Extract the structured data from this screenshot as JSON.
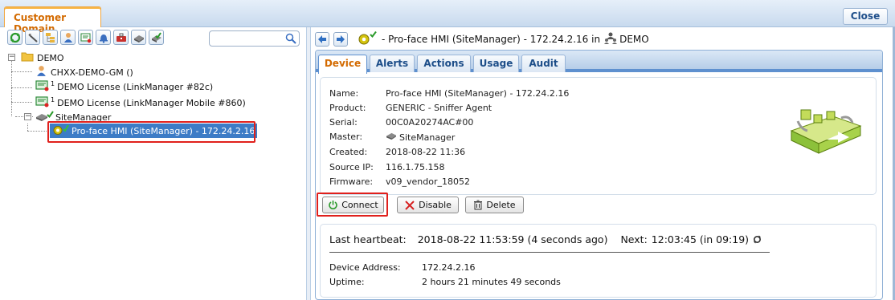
{
  "window": {
    "tab_title": "Customer Domain",
    "close_label": "Close"
  },
  "search": {
    "value": "",
    "placeholder": ""
  },
  "toolbar": {
    "icons": [
      "refresh-icon",
      "tools-icon",
      "hierarchy-icon",
      "user-icon",
      "certificate-icon",
      "alarm-icon",
      "toolbox-icon",
      "device-icon",
      "device-check-icon"
    ]
  },
  "tree": {
    "root": "DEMO",
    "items": [
      {
        "label": "CHXX-DEMO-GM ()",
        "icon": "user-icon"
      },
      {
        "label": "DEMO License (LinkManager #82c)",
        "icon": "license-icon",
        "superscript": "1"
      },
      {
        "label": "DEMO License (LinkManager Mobile #860)",
        "icon": "license-icon",
        "superscript": "1"
      },
      {
        "label": "SiteManager",
        "icon": "sitemanager-icon"
      },
      {
        "label": "Pro-face HMI (SiteManager) - 172.24.2.16",
        "icon": "agent-gear-icon",
        "selected": true
      }
    ]
  },
  "header": {
    "title": "- Pro-face HMI (SiteManager) - 172.24.2.16 in",
    "domain": "DEMO"
  },
  "tabs": [
    {
      "label": "Device",
      "active": true
    },
    {
      "label": "Alerts"
    },
    {
      "label": "Actions"
    },
    {
      "label": "Usage"
    },
    {
      "label": "Audit"
    }
  ],
  "details": {
    "name_label": "Name:",
    "name": "Pro-face HMI (SiteManager) - 172.24.2.16",
    "product_label": "Product:",
    "product": "GENERIC - Sniffer Agent",
    "serial_label": "Serial:",
    "serial": "00C0A20274AC#00",
    "master_label": "Master:",
    "master": "SiteManager",
    "created_label": "Created:",
    "created": "2018-08-22 11:36",
    "source_ip_label": "Source IP:",
    "source_ip": "116.1.75.158",
    "firmware_label": "Firmware:",
    "firmware": "v09_vendor_18052"
  },
  "actions": {
    "connect": "Connect",
    "disable": "Disable",
    "delete": "Delete"
  },
  "status": {
    "heartbeat_label": "Last heartbeat:",
    "heartbeat_value": "2018-08-22 11:53:59 (4 seconds ago)",
    "next_label": "Next:",
    "next_value": "12:03:45 (in 09:19)",
    "device_address_label": "Device Address:",
    "device_address": "172.24.2.16",
    "uptime_label": "Uptime:",
    "uptime": "2 hours 21 minutes 49 seconds"
  },
  "colors": {
    "accent": "#d36a00",
    "highlight": "#e0201c",
    "selection": "#3d7cc6",
    "tab_text": "#1d4e89"
  }
}
